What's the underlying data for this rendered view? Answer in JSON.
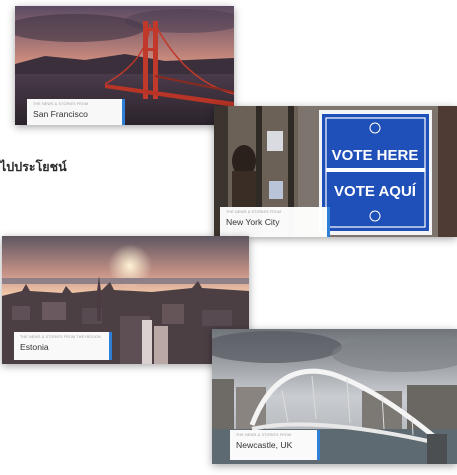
{
  "page": {
    "partial_text": "ไปประโยชน์"
  },
  "cards": [
    {
      "city": "San Francisco",
      "kicker": "THE NEWS & STORIES FROM"
    },
    {
      "city": "New York City",
      "kicker": "THE NEWS & STORIES FROM",
      "sign_line1": "VOTE HERE",
      "sign_line2": "VOTE AQUÍ"
    },
    {
      "city": "Estonia",
      "kicker": "THE NEWS & STORIES FROM THE REGION"
    },
    {
      "city": "Newcastle, UK",
      "kicker": "THE NEWS & STORIES FROM"
    }
  ],
  "colors": {
    "accent": "#2f7fd6",
    "sign_blue": "#1f4fb8"
  }
}
